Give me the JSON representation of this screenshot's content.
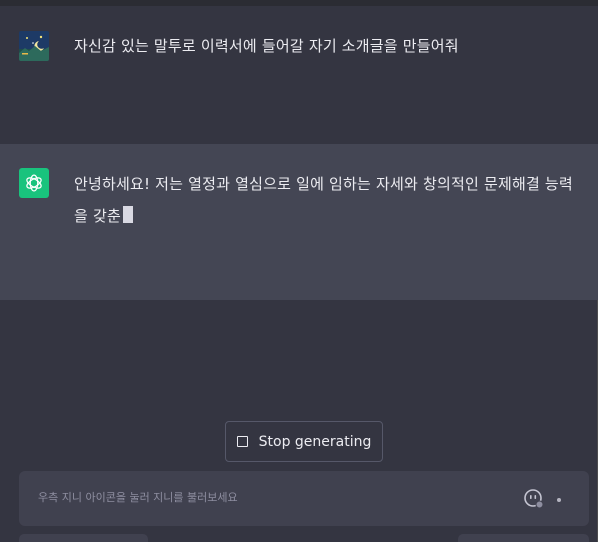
{
  "conversation": {
    "user_message": "자신감 있는 말투로 이력서에 들어갈 자기 소개글을 만들어줘",
    "assistant_message": "안녕하세요! 저는 열정과 열심으로 일에 임하는 자세와 창의적인 문제해결 능력을 갖춘"
  },
  "controls": {
    "stop_label": "Stop generating"
  },
  "input": {
    "placeholder": "우측 지니 아이콘을 눌러 지니를 불러보세요"
  },
  "icons": {
    "user_avatar": "user-avatar-night-image",
    "bot_avatar": "openai-logo-icon",
    "stop": "stop-square-icon",
    "assistant": "smiley-face-icon"
  },
  "colors": {
    "background": "#343541",
    "assistant_row": "#444654",
    "input": "#40414f",
    "bot_avatar": "#19c37d",
    "text": "#ececf1"
  }
}
